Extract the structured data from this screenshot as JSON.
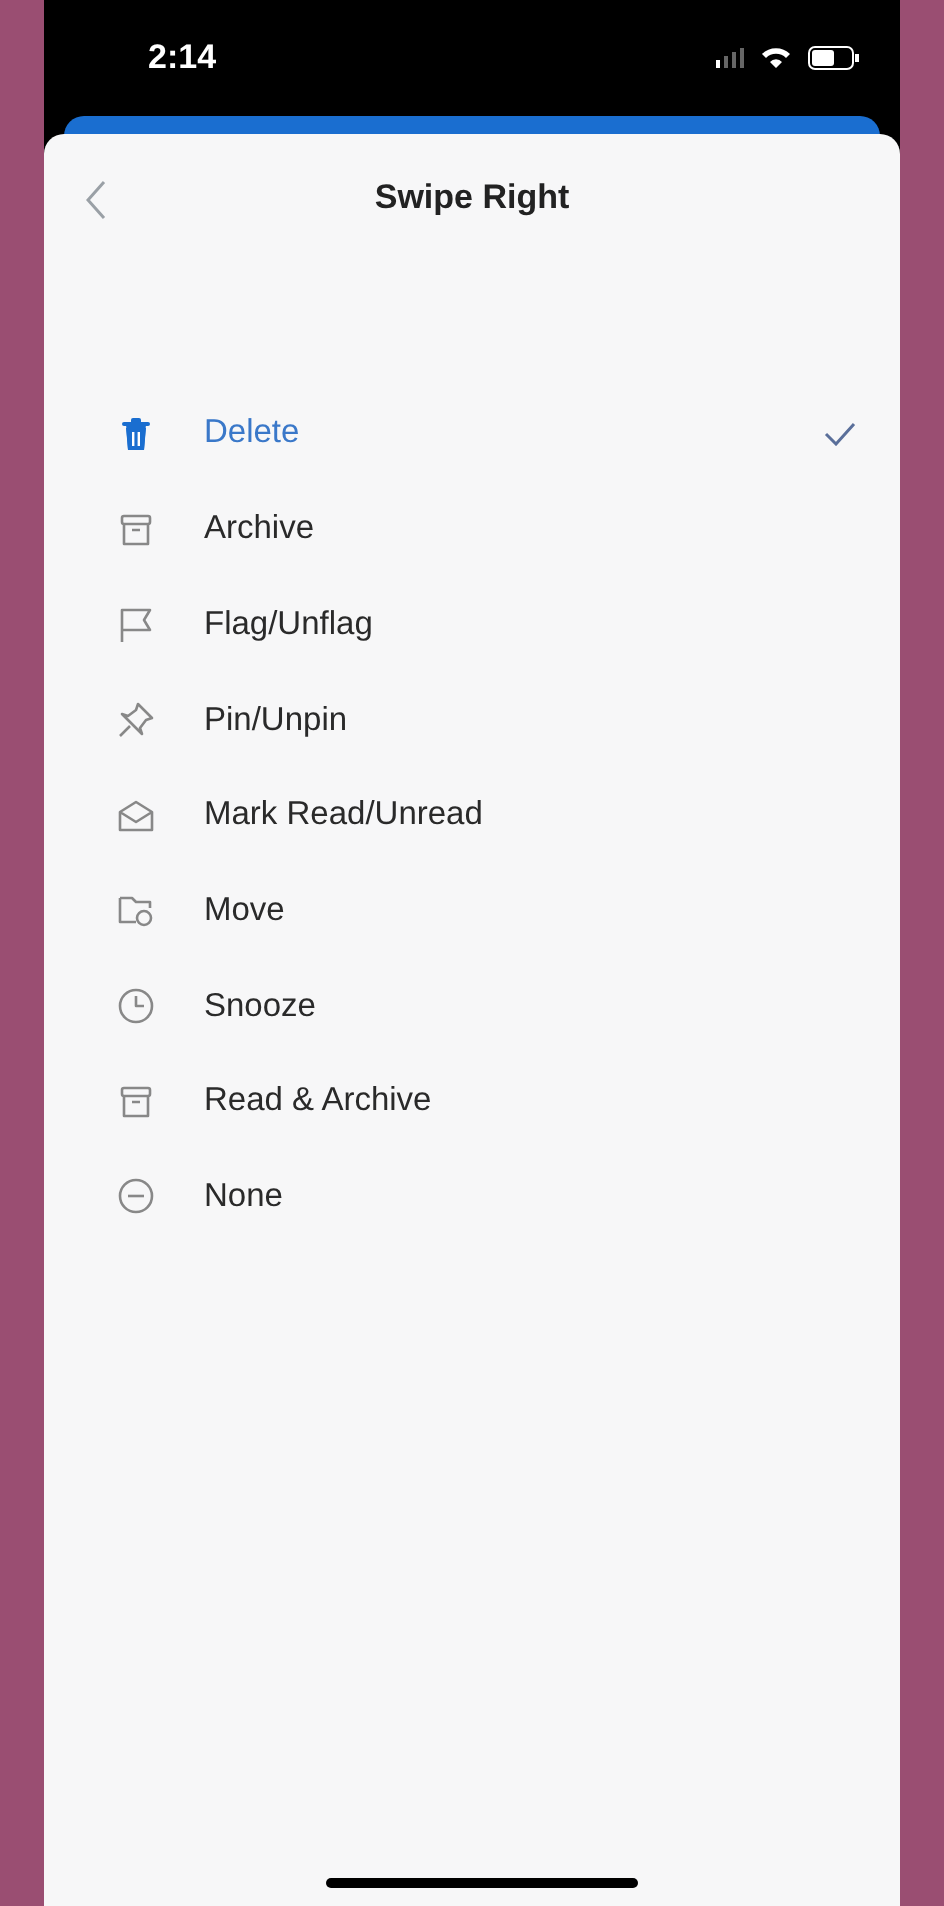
{
  "status_bar": {
    "time": "2:14"
  },
  "header": {
    "title": "Swipe Right"
  },
  "options": [
    {
      "label": "Delete",
      "kind": "trash",
      "selected": true
    },
    {
      "label": "Archive",
      "kind": "archive",
      "selected": false
    },
    {
      "label": "Flag/Unflag",
      "kind": "flag",
      "selected": false
    },
    {
      "label": "Pin/Unpin",
      "kind": "pin",
      "selected": false
    },
    {
      "label": "Mark Read/Unread",
      "kind": "envelope",
      "selected": false
    },
    {
      "label": "Move",
      "kind": "folder",
      "selected": false
    },
    {
      "label": "Snooze",
      "kind": "clock",
      "selected": false
    },
    {
      "label": "Read & Archive",
      "kind": "archive",
      "selected": false
    },
    {
      "label": "None",
      "kind": "none",
      "selected": false
    }
  ]
}
